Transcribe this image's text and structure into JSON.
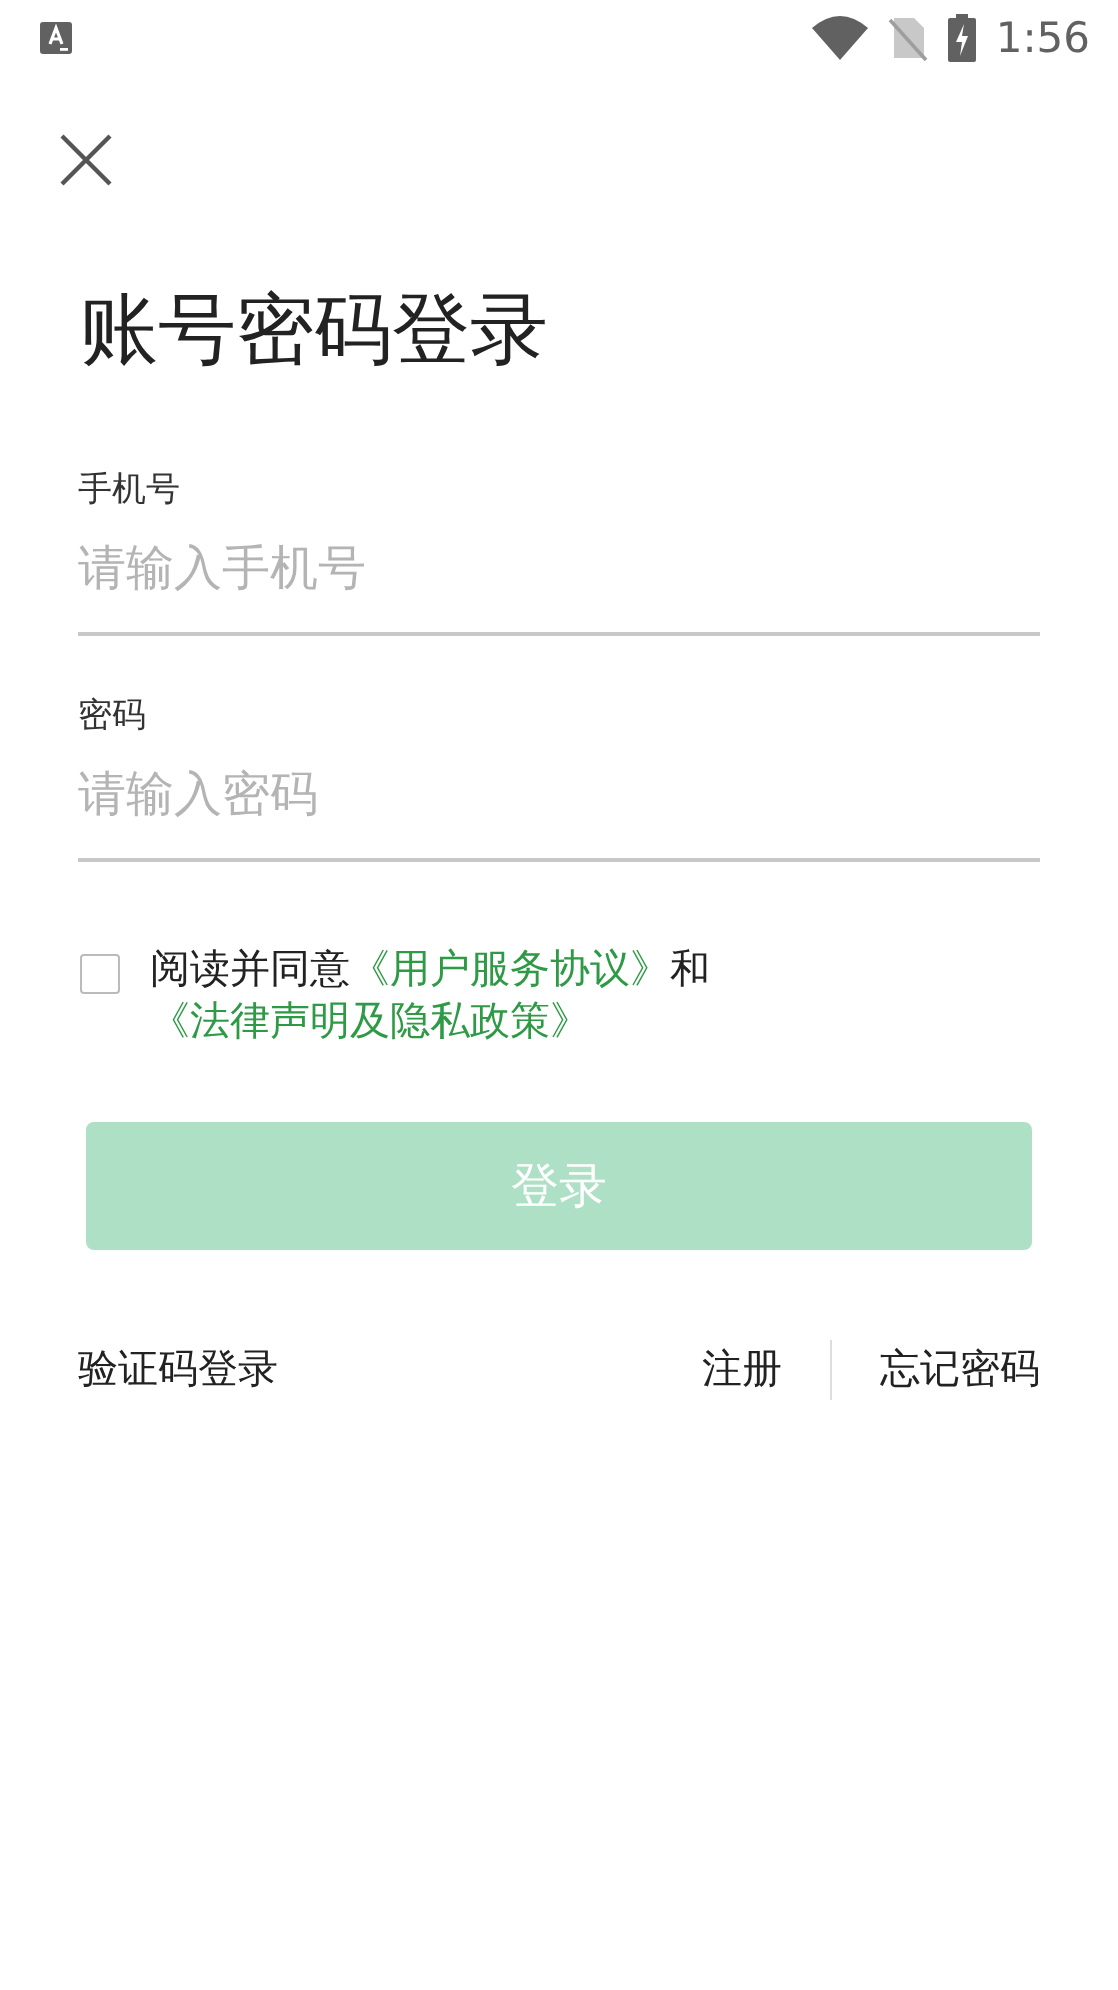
{
  "status_bar": {
    "time": "1:56"
  },
  "title": "账号密码登录",
  "fields": [
    {
      "label": "手机号",
      "placeholder": "请输入手机号"
    },
    {
      "label": "密码",
      "placeholder": "请输入密码"
    }
  ],
  "agreement": {
    "checked": false,
    "parts": [
      {
        "kind": "text",
        "text": "阅读并同意"
      },
      {
        "kind": "link",
        "text": "《用户服务协议》"
      },
      {
        "kind": "text",
        "text": "和"
      },
      {
        "kind": "link",
        "text": "《法律声明及隐私政策》"
      }
    ]
  },
  "login_button": {
    "label": "登录",
    "disabled": true
  },
  "links": {
    "left": "验证码登录",
    "right": [
      "注册",
      "忘记密码"
    ]
  }
}
